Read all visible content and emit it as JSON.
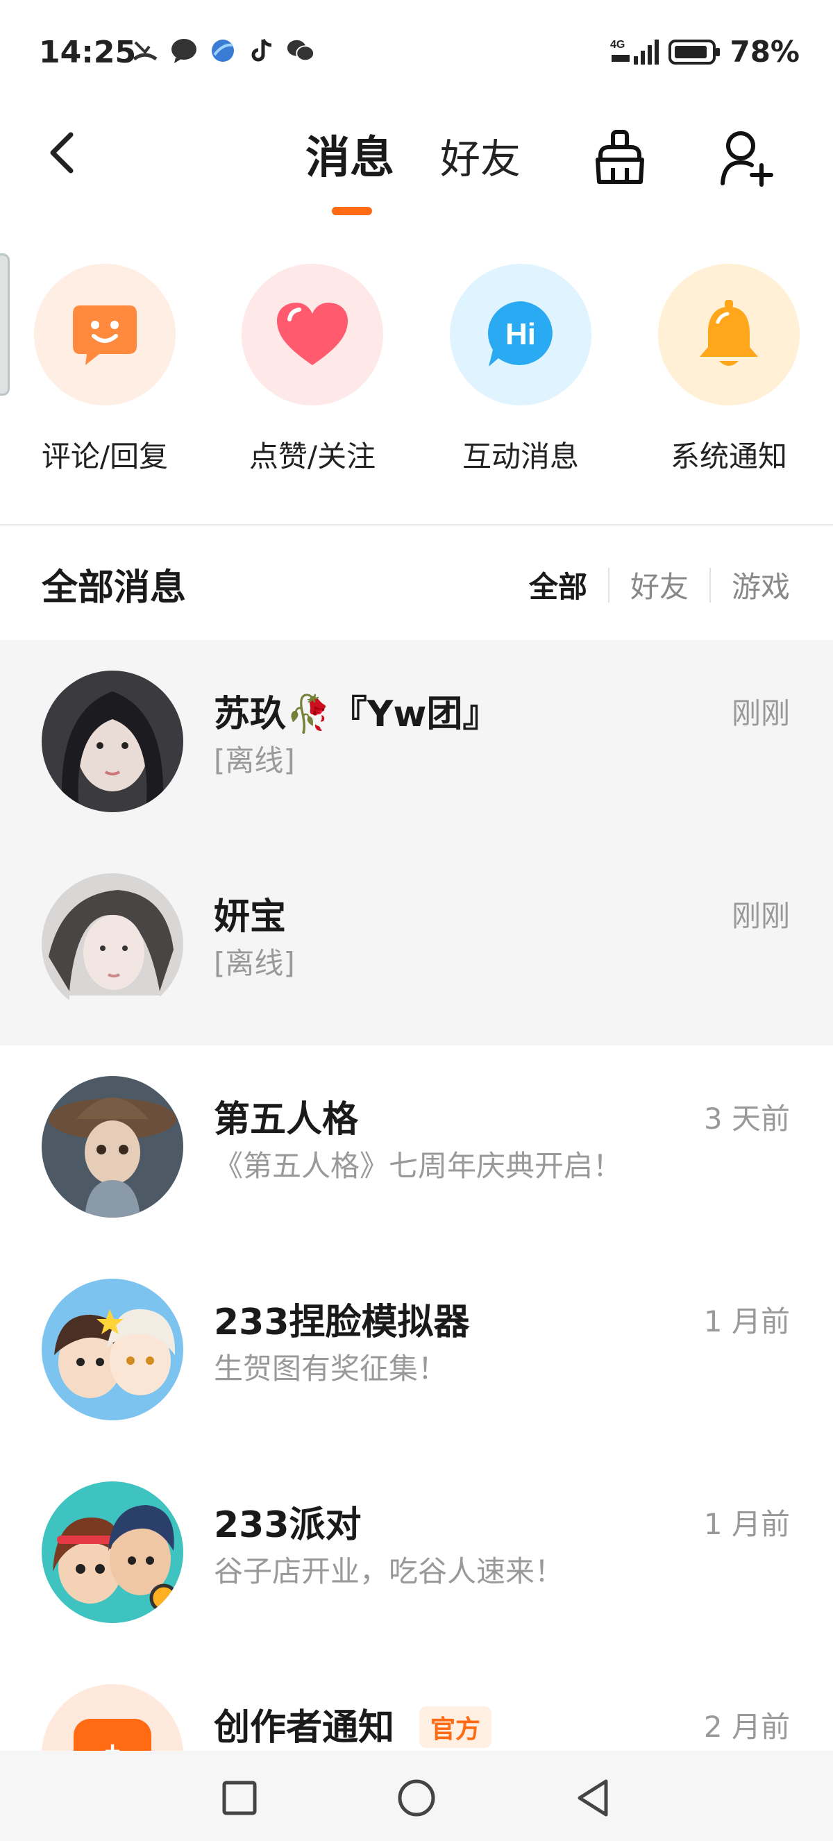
{
  "status_bar": {
    "time": "14:25",
    "network": "4G",
    "battery": "78%"
  },
  "nav": {
    "tab_messages": "消息",
    "tab_friends": "好友",
    "accent": "#ff6a13"
  },
  "categories": [
    {
      "label": "评论/回复",
      "icon": "comment-smile-icon",
      "bg": "#ffeee3",
      "color": "#ff8a3d"
    },
    {
      "label": "点赞/关注",
      "icon": "heart-icon",
      "bg": "#ffe8e8",
      "color": "#ff5a6e"
    },
    {
      "label": "互动消息",
      "icon": "hi-bubble-icon",
      "bg": "#e0f4ff",
      "color": "#2aaaf2"
    },
    {
      "label": "系统通知",
      "icon": "bell-icon",
      "bg": "#fff0d6",
      "color": "#ffa61a"
    }
  ],
  "section": {
    "title": "全部消息",
    "filters": [
      "全部",
      "好友",
      "游戏"
    ]
  },
  "messages": [
    {
      "name": "苏玖🥀『Yw团』",
      "preview": "[离线]",
      "time": "刚刚",
      "highlight": true
    },
    {
      "name": "妍宝",
      "preview": "[离线]",
      "time": "刚刚",
      "highlight": true
    },
    {
      "name": "第五人格",
      "preview": "《第五人格》七周年庆典开启！",
      "time": "3 天前",
      "highlight": false
    },
    {
      "name": "233捏脸模拟器",
      "preview": "生贺图有奖征集！",
      "time": "1 月前",
      "highlight": false
    },
    {
      "name": "233派对",
      "preview": "谷子店开业，吃谷人速来！",
      "time": "1 月前",
      "highlight": false
    },
    {
      "name": "创作者通知",
      "badge": "官方",
      "preview": "",
      "time": "2 月前",
      "highlight": false
    }
  ]
}
